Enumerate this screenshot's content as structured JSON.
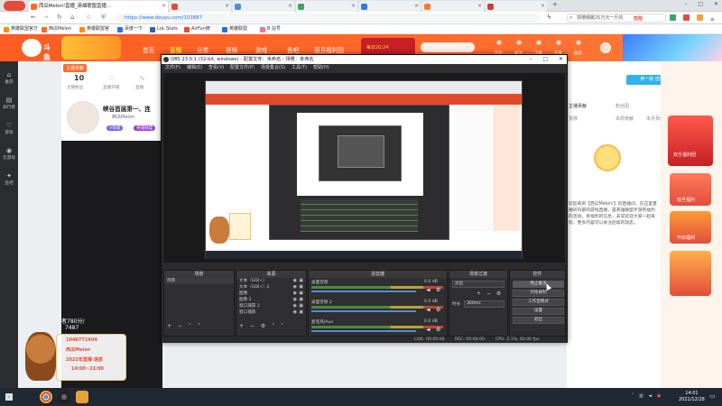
{
  "browser": {
    "tabs": [
      {
        "label": "西瓜Melon!直播_英雄联盟直播...",
        "color": "#ff6a2a"
      },
      {
        "label": "",
        "color": "#e24d3b"
      },
      {
        "label": "",
        "color": "#4a90d9"
      },
      {
        "label": "",
        "color": "#3aa564"
      },
      {
        "label": "",
        "color": "#2b7de9"
      },
      {
        "label": "",
        "color": "#ff7a2a"
      },
      {
        "label": "",
        "color": "#d23c3c"
      }
    ],
    "url": "https://www.douyu.com/103887",
    "search_placeholder": "郭德纲跳25万元一斤的",
    "warning_label": "危险",
    "bookmarks": [
      {
        "label": "英雄联盟官方",
        "color": "#ff8b1a"
      },
      {
        "label": "西瓜Melon",
        "color": "#ff6a2a"
      },
      {
        "label": "英雄联盟官",
        "color": "#ff8b1a"
      },
      {
        "label": "百度一下",
        "color": "#2e6fe8"
      },
      {
        "label": "LoL Stats",
        "color": "#3b5bb5"
      },
      {
        "label": "AirFun牌",
        "color": "#e24d3b"
      },
      {
        "label": "英雄联盟",
        "color": "#2d6be0"
      },
      {
        "label": "B 站号",
        "color": "#fb7299"
      }
    ]
  },
  "douyu": {
    "logo_text": "斗鱼",
    "nav": [
      "首页",
      "直播",
      "分类",
      "视频",
      "游戏",
      "鱼吧",
      "双旦福利团"
    ],
    "promo_text": "每日20:24",
    "right_icons": [
      "历史",
      "关注",
      "下载",
      "开播",
      "鱼翅"
    ],
    "left_rail": [
      {
        "icon": "⌂",
        "label": "推荐"
      },
      {
        "icon": "▤",
        "label": "排行榜"
      },
      {
        "icon": "♡",
        "label": "游戏"
      },
      {
        "icon": "◉",
        "label": "云游戏"
      },
      {
        "icon": "✦",
        "label": "鱼吧"
      }
    ],
    "room": {
      "badge": "主播贡献",
      "stat_value": "10",
      "stat_label": "主播粉丝",
      "labels": [
        "直播开播",
        "直播"
      ],
      "title": "峡谷首届第一、连",
      "streamer": "西瓜Melon",
      "tag": "V等级",
      "category": "英雄联盟",
      "overlay_line1": "者780分/",
      "overlay_line2": "7487",
      "qq_line": "1046771604",
      "douyin_line": "西瓜Melon",
      "schedule_title": "2022年直播·速度",
      "schedule_time": "14:00~21:00"
    },
    "side": {
      "tabs": [
        "主播贡献",
        "粉丝团",
        "贵族",
        "本周贡献",
        "本月贡献"
      ],
      "notice": "欢迎来到【西瓜Melon!】的直播间，在这里直播间内部的游戏直播，是英雄联盟手游有福利的活动，有福利的信息，非常欢迎大家一起来玩，更多内容可以关注后续的动态。",
      "join_label": "用一枚 送福利"
    },
    "ads": [
      "双旦福利团",
      "双旦福利",
      "开启福利"
    ]
  },
  "obs": {
    "title": "OBS 23.0.1 (32-bit, windows) - 配置文件：未命名 - 场景：未命名",
    "menu": [
      "文件(F)",
      "编辑(E)",
      "查看(V)",
      "配置文件(P)",
      "场景集合(S)",
      "工具(T)",
      "帮助(H)"
    ],
    "docks": {
      "scenes": {
        "title": "场景",
        "items": [
          "场景"
        ]
      },
      "sources": {
        "title": "来源",
        "items": [
          "文本（GDI+）",
          "文本（GDI+）2",
          "图像",
          "图像 2",
          "窗口捕获 2",
          "窗口捕获"
        ]
      },
      "mixer": {
        "title": "混音器",
        "tracks": [
          {
            "name": "桌面音频",
            "db": "0.0 dB"
          },
          {
            "name": "桌面音频 2",
            "db": "0.0 dB"
          },
          {
            "name": "麦克风/Aux",
            "db": "0.0 dB"
          }
        ]
      },
      "transitions": {
        "title": "场景过渡",
        "mode": "淡出",
        "duration_label": "时长",
        "duration": "300ms"
      },
      "controls": {
        "title": "控件",
        "buttons": [
          "停止推流",
          "开始录制",
          "工作室模式",
          "设置",
          "退出"
        ]
      }
    },
    "status": {
      "live": "LIVE: 00:00:00",
      "rec": "REC: 00:00:00",
      "cpu": "CPU: 2.1%, 60.00 fps"
    }
  },
  "taskbar": {
    "time": "14:01",
    "date": "2021/12/28"
  }
}
